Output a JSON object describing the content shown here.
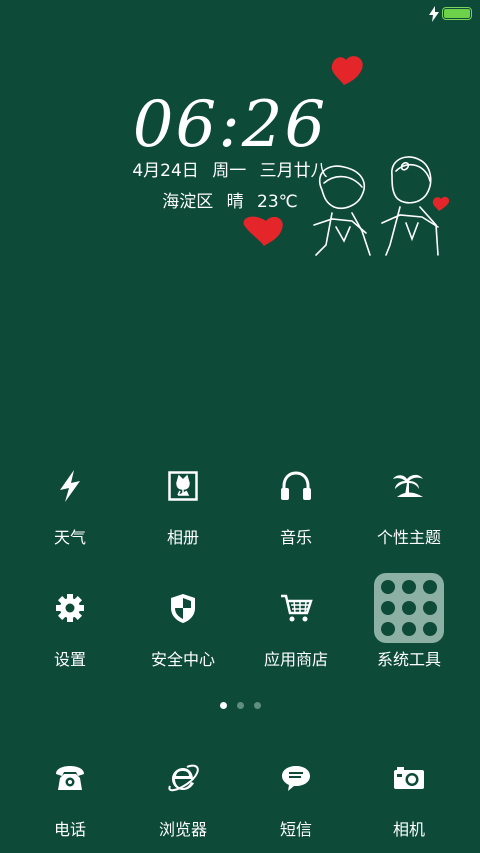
{
  "status_bar": {
    "charging_icon": "lightning-bolt-icon",
    "battery_icon": "battery-full-icon",
    "battery_level": 1.0,
    "battery_color": "#6ed14a"
  },
  "clock": {
    "time": "06:26",
    "date": "4月24日  周一  三月廿八",
    "weather": "海淀区  晴  23℃"
  },
  "wallpaper": {
    "background_color": "#0e4a38",
    "heart_color": "#e4262a"
  },
  "apps_row1": [
    {
      "label": "天气",
      "icon": "lightning-icon"
    },
    {
      "label": "相册",
      "icon": "tulip-photo-icon"
    },
    {
      "label": "音乐",
      "icon": "headphones-icon"
    },
    {
      "label": "个性主题",
      "icon": "palm-island-icon"
    }
  ],
  "apps_row2": [
    {
      "label": "设置",
      "icon": "gear-icon"
    },
    {
      "label": "安全中心",
      "icon": "shield-icon"
    },
    {
      "label": "应用商店",
      "icon": "shopping-cart-icon"
    },
    {
      "label": "系统工具",
      "icon": "folder-icon"
    }
  ],
  "pager": {
    "pages": 3,
    "current": 1
  },
  "dock": [
    {
      "label": "电话",
      "icon": "telephone-icon"
    },
    {
      "label": "浏览器",
      "icon": "browser-e-icon"
    },
    {
      "label": "短信",
      "icon": "message-bubble-icon"
    },
    {
      "label": "相机",
      "icon": "camera-icon"
    }
  ]
}
